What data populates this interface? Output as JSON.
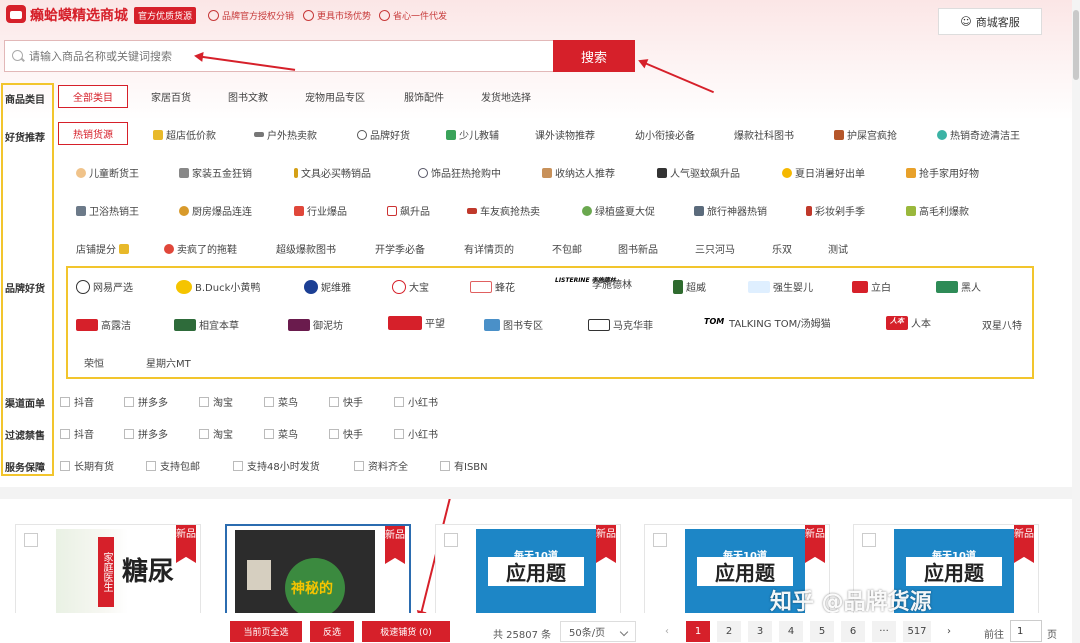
{
  "header": {
    "brand": "癞蛤蟆精选商城",
    "badge": "官方优质货源",
    "perks": [
      "品牌官方授权分销",
      "更具市场优势",
      "省心一件代发"
    ],
    "service": "商城客服"
  },
  "search": {
    "placeholder": "请输入商品名称或关键词搜索",
    "button": "搜索"
  },
  "categories": {
    "label": "商品类目",
    "items": [
      "全部类目",
      "家居百货",
      "图书文教",
      "宠物用品专区",
      "服饰配件",
      "发货地选择"
    ]
  },
  "recommend": {
    "label": "好货推荐",
    "rows": [
      [
        "热销货源",
        "超店低价款",
        "户外热卖款",
        "品牌好货",
        "少儿教辅",
        "课外读物推荐",
        "幼小衔接必备",
        "爆款社科图书",
        "护屎宫疯抢",
        "热销奇迹清洁王"
      ],
      [
        "儿童断货王",
        "家装五金狂销",
        "文具必买畅销品",
        "饰品狂热抢购中",
        "收纳达人推荐",
        "人气驱蚊飙升品",
        "夏日消暑好出单",
        "抢手家用好物"
      ],
      [
        "卫浴热销王",
        "厨房爆品连连",
        "行业爆品",
        "飙升品",
        "车友疯抢热卖",
        "绿植盛夏大促",
        "旅行神器热销",
        "彩妆剁手季",
        "高毛利爆款"
      ],
      [
        "店铺提分",
        "卖疯了的拖鞋",
        "超级爆款图书",
        "开学季必备",
        "有详情页的",
        "不包邮",
        "图书新品",
        "三只河马",
        "乐双",
        "测试"
      ]
    ]
  },
  "brands": {
    "label": "品牌好货",
    "rows": [
      [
        "网易严选",
        "B.Duck小黄鸭",
        "妮维雅",
        "大宝",
        "蜂花",
        "李施德林",
        "超威",
        "强生婴儿",
        "立白",
        "黑人"
      ],
      [
        "高露洁",
        "相宜本草",
        "御泥坊",
        "平望",
        "图书专区",
        "马克华菲",
        "TALKING TOM/汤姆猫",
        "人本",
        "双星八特"
      ],
      [
        "荣恒",
        "星期六MT"
      ]
    ],
    "logo_marks": [
      "LISTERINE 李施德林",
      "TOM",
      "人本"
    ]
  },
  "channel": {
    "label": "渠道面单",
    "options": [
      "抖音",
      "拼多多",
      "淘宝",
      "菜鸟",
      "快手",
      "小红书"
    ]
  },
  "filter": {
    "label": "过滤禁售",
    "options": [
      "抖音",
      "拼多多",
      "淘宝",
      "菜鸟",
      "快手",
      "小红书"
    ]
  },
  "service": {
    "label": "服务保障",
    "options": [
      "长期有货",
      "支持包邮",
      "支持48小时发货",
      "资料齐全",
      "有ISBN"
    ]
  },
  "products": [
    {
      "badge": "新品",
      "title": "糖尿",
      "subtitle": "家庭医生"
    },
    {
      "badge": "新品",
      "title": "神秘的",
      "subtitle": ""
    },
    {
      "badge": "新品",
      "title": "应用题",
      "subtitle": "每天10道"
    },
    {
      "badge": "新品",
      "title": "应用题",
      "subtitle": "每天10道"
    },
    {
      "badge": "新品",
      "title": "应用题",
      "subtitle": "每天10道"
    }
  ],
  "bottom": {
    "select_page": "当前页全选",
    "invert": "反选",
    "quick": "极速铺货 (0)",
    "total": "共 25807 条",
    "page_size": "50条/页",
    "pages": [
      "1",
      "2",
      "3",
      "4",
      "5",
      "6",
      "···",
      "517"
    ],
    "prev": "‹",
    "next": "›",
    "goto_prefix": "前往",
    "goto_value": "1",
    "goto_suffix": "页"
  },
  "watermark": "知乎 @品牌货源",
  "colors": {
    "accent": "#d6202a",
    "highlight": "#f2c52d",
    "selected": "#2b6cb0"
  }
}
